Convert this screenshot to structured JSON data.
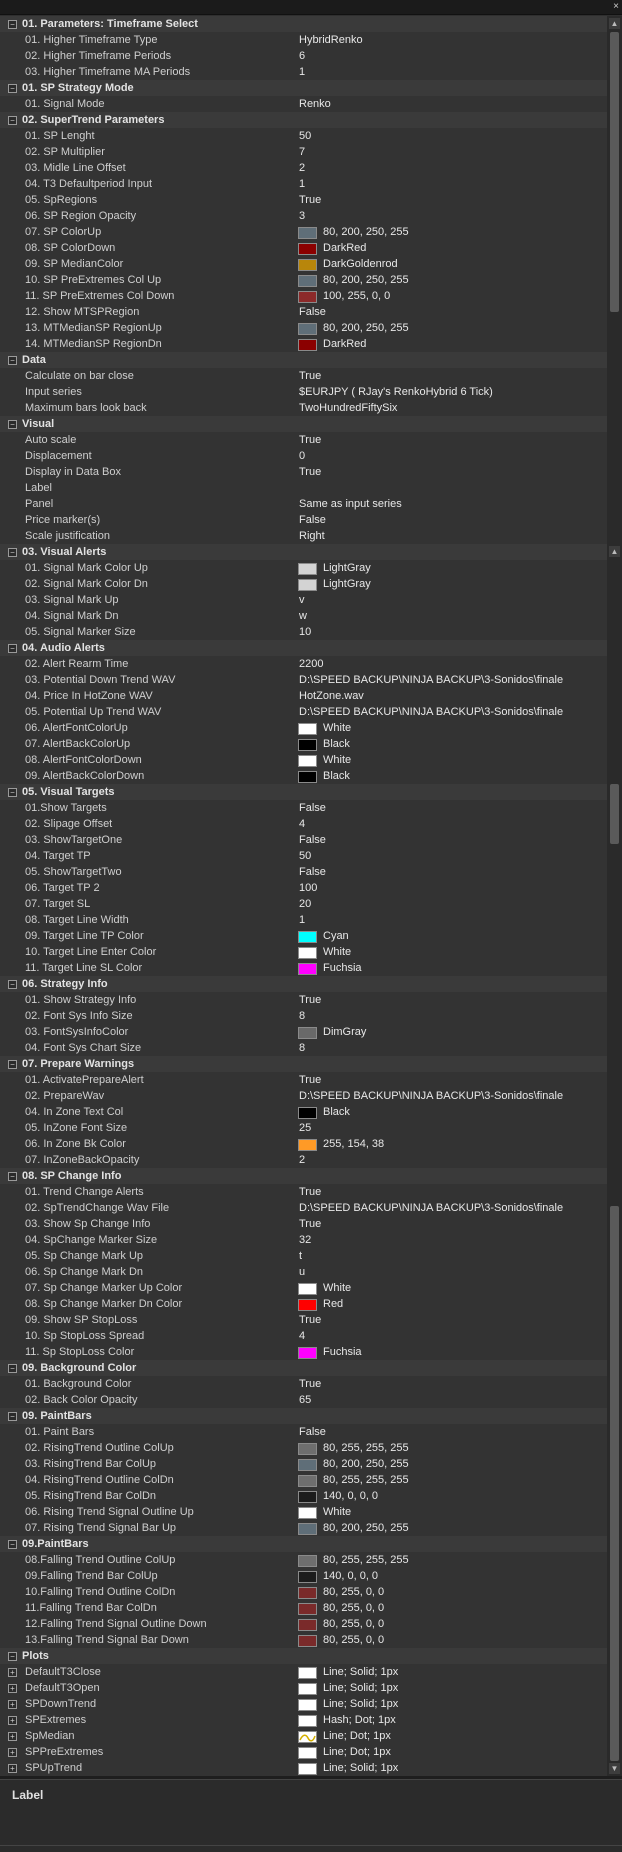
{
  "window": {
    "close_glyph": "×"
  },
  "grid": {
    "categories": [
      {
        "label": "01. Parameters: Timeframe Select",
        "toggle": "−",
        "props": [
          {
            "name": "01. Higher Timeframe Type",
            "value": "HybridRenko"
          },
          {
            "name": "02. Higher Timeframe Periods",
            "value": "6"
          },
          {
            "name": "03. Higher Timeframe MA Periods",
            "value": "1"
          }
        ]
      },
      {
        "label": "01. SP Strategy Mode",
        "toggle": "−",
        "props": [
          {
            "name": "01. Signal Mode",
            "value": "Renko"
          }
        ]
      },
      {
        "label": "02. SuperTrend Parameters",
        "toggle": "−",
        "props": [
          {
            "name": "01. SP Lenght",
            "value": "50"
          },
          {
            "name": "02. SP Multiplier",
            "value": "7"
          },
          {
            "name": "03. Midle Line Offset",
            "value": "2"
          },
          {
            "name": "04. T3 Defaultperiod Input",
            "value": "1"
          },
          {
            "name": "05. SpRegions",
            "value": "True"
          },
          {
            "name": "06. SP Region Opacity",
            "value": "3"
          },
          {
            "name": "07. SP ColorUp",
            "value": "80, 200, 250, 255",
            "swatch": "#5f6e78"
          },
          {
            "name": "08. SP ColorDown",
            "value": "DarkRed",
            "swatch": "#8b0000"
          },
          {
            "name": "09. SP MedianColor",
            "value": "DarkGoldenrod",
            "swatch": "#b8860b"
          },
          {
            "name": "10. SP PreExtremes Col Up",
            "value": "80, 200, 250, 255",
            "swatch": "#5f6e78"
          },
          {
            "name": "11. SP PreExtremes Col Down",
            "value": "100, 255, 0, 0",
            "swatch": "#8c2a2a"
          },
          {
            "name": "12. Show MTSPRegion",
            "value": "False"
          },
          {
            "name": "13. MTMedianSP RegionUp",
            "value": "80, 200, 250, 255",
            "swatch": "#5f6e78"
          },
          {
            "name": "14. MTMedianSP RegionDn",
            "value": "DarkRed",
            "swatch": "#8b0000"
          }
        ]
      },
      {
        "label": "Data",
        "toggle": "−",
        "props": [
          {
            "name": "Calculate on bar close",
            "value": "True"
          },
          {
            "name": "Input series",
            "value": "$EURJPY ( RJay's RenkoHybrid  6 Tick)"
          },
          {
            "name": "Maximum bars look back",
            "value": "TwoHundredFiftySix"
          }
        ]
      },
      {
        "label": "Visual",
        "toggle": "−",
        "props": [
          {
            "name": "Auto scale",
            "value": "True"
          },
          {
            "name": "Displacement",
            "value": "0"
          },
          {
            "name": "Display in Data Box",
            "value": "True"
          },
          {
            "name": "Label",
            "value": ""
          },
          {
            "name": "Panel",
            "value": "Same as input series"
          },
          {
            "name": "Price marker(s)",
            "value": "False"
          },
          {
            "name": "Scale justification",
            "value": "Right"
          }
        ]
      },
      {
        "label": "03. Visual Alerts",
        "toggle": "−",
        "props": [
          {
            "name": "01. Signal Mark Color Up",
            "value": "LightGray",
            "swatch": "#d3d3d3"
          },
          {
            "name": "02. Signal Mark Color Dn",
            "value": "LightGray",
            "swatch": "#d3d3d3"
          },
          {
            "name": "03. Signal Mark Up",
            "value": "v"
          },
          {
            "name": "04. Signal Mark Dn",
            "value": "w"
          },
          {
            "name": "05. Signal Marker Size",
            "value": "10"
          }
        ]
      },
      {
        "label": "04. Audio Alerts",
        "toggle": "−",
        "props": [
          {
            "name": "02. Alert Rearm Time",
            "value": "2200"
          },
          {
            "name": "03. Potential Down Trend WAV",
            "value": "D:\\SPEED BACKUP\\NINJA BACKUP\\3-Sonidos\\finale"
          },
          {
            "name": "04. Price In HotZone WAV",
            "value": "HotZone.wav"
          },
          {
            "name": "05. Potential Up Trend WAV",
            "value": "D:\\SPEED BACKUP\\NINJA BACKUP\\3-Sonidos\\finale"
          },
          {
            "name": "06. AlertFontColorUp",
            "value": "White",
            "swatch": "#ffffff"
          },
          {
            "name": "07. AlertBackColorUp",
            "value": "Black",
            "swatch": "#000000"
          },
          {
            "name": "08. AlertFontColorDown",
            "value": "White",
            "swatch": "#ffffff"
          },
          {
            "name": "09. AlertBackColorDown",
            "value": "Black",
            "swatch": "#000000"
          }
        ]
      },
      {
        "label": "05. Visual Targets",
        "toggle": "−",
        "props": [
          {
            "name": "01.Show Targets",
            "value": "False"
          },
          {
            "name": "02. Slipage Offset",
            "value": "4"
          },
          {
            "name": "03. ShowTargetOne",
            "value": "False"
          },
          {
            "name": "04. Target TP",
            "value": "50"
          },
          {
            "name": "05. ShowTargetTwo",
            "value": "False"
          },
          {
            "name": "06. Target TP 2",
            "value": "100"
          },
          {
            "name": "07. Target SL",
            "value": "20"
          },
          {
            "name": "08. Target Line Width",
            "value": "1"
          },
          {
            "name": "09. Target Line TP Color",
            "value": "Cyan",
            "swatch": "#00ffff"
          },
          {
            "name": "10. Target Line Enter Color",
            "value": "White",
            "swatch": "#ffffff"
          },
          {
            "name": "11. Target Line SL Color",
            "value": "Fuchsia",
            "swatch": "#ff00ff"
          }
        ]
      },
      {
        "label": "06. Strategy Info",
        "toggle": "−",
        "props": [
          {
            "name": " 01. Show Strategy Info",
            "value": "True"
          },
          {
            "name": "02. Font Sys Info Size",
            "value": "8"
          },
          {
            "name": "03. FontSysInfoColor",
            "value": "DimGray",
            "swatch": "#696969"
          },
          {
            "name": "04. Font Sys Chart Size",
            "value": "8"
          }
        ]
      },
      {
        "label": "07. Prepare Warnings",
        "toggle": "−",
        "props": [
          {
            "name": " 01. ActivatePrepareAlert",
            "value": "True"
          },
          {
            "name": "02. PrepareWav",
            "value": "D:\\SPEED BACKUP\\NINJA BACKUP\\3-Sonidos\\finale"
          },
          {
            "name": "04. In Zone Text Col",
            "value": "Black",
            "swatch": "#000000"
          },
          {
            "name": "05. InZone Font Size",
            "value": "25"
          },
          {
            "name": "06. In Zone Bk Color",
            "value": "255, 154, 38",
            "swatch": "#ff9a26"
          },
          {
            "name": "07. InZoneBackOpacity",
            "value": "2"
          }
        ]
      },
      {
        "label": "08. SP Change Info",
        "toggle": "−",
        "props": [
          {
            "name": "01. Trend Change Alerts",
            "value": "True"
          },
          {
            "name": "02. SpTrendChange Wav File",
            "value": "D:\\SPEED BACKUP\\NINJA BACKUP\\3-Sonidos\\finale"
          },
          {
            "name": "03. Show Sp Change Info",
            "value": "True"
          },
          {
            "name": "04. SpChange Marker Size",
            "value": "32"
          },
          {
            "name": "05. Sp Change Mark Up",
            "value": "t"
          },
          {
            "name": "06. Sp Change Mark Dn",
            "value": "u"
          },
          {
            "name": "07. Sp Change Marker Up Color",
            "value": "White",
            "swatch": "#ffffff"
          },
          {
            "name": "08. Sp Change Marker Dn Color",
            "value": "Red",
            "swatch": "#ff0000"
          },
          {
            "name": "09. Show SP StopLoss",
            "value": "True"
          },
          {
            "name": "10. Sp StopLoss Spread",
            "value": "4"
          },
          {
            "name": "11. Sp StopLoss Color",
            "value": "Fuchsia",
            "swatch": "#ff00ff"
          }
        ]
      },
      {
        "label": "09. Background Color",
        "toggle": "−",
        "props": [
          {
            "name": "01. Background Color",
            "value": "True"
          },
          {
            "name": "02. Back Color  Opacity",
            "value": "65"
          }
        ]
      },
      {
        "label": "09. PaintBars",
        "toggle": "−",
        "props": [
          {
            "name": "01. Paint Bars",
            "value": "False"
          },
          {
            "name": "02. RisingTrend Outline ColUp",
            "value": "80, 255, 255, 255",
            "swatch": "#6e6e6e"
          },
          {
            "name": "03. RisingTrend Bar ColUp",
            "value": "80, 200, 250, 255",
            "swatch": "#5f6e78"
          },
          {
            "name": "04. RisingTrend Outline ColDn",
            "value": "80, 255, 255, 255",
            "swatch": "#6e6e6e"
          },
          {
            "name": "05. RisingTrend Bar ColDn",
            "value": "140, 0, 0, 0",
            "swatch": "#1c1c1c"
          },
          {
            "name": "06. Rising Trend Signal Outline Up",
            "value": "White",
            "swatch": "#ffffff"
          },
          {
            "name": "07. Rising Trend Signal Bar Up",
            "value": "80, 200, 250, 255",
            "swatch": "#5f6e78"
          }
        ]
      },
      {
        "label": "09.PaintBars",
        "toggle": "−",
        "props": [
          {
            "name": "08.Falling Trend Outline ColUp",
            "value": "80, 255, 255, 255",
            "swatch": "#6e6e6e"
          },
          {
            "name": "09.Falling Trend Bar ColUp",
            "value": "140, 0, 0, 0",
            "swatch": "#1c1c1c"
          },
          {
            "name": "10.Falling Trend Outline ColDn",
            "value": "80, 255, 0, 0",
            "swatch": "#7a2a2a"
          },
          {
            "name": "11.Falling Trend Bar ColDn",
            "value": "80, 255, 0, 0",
            "swatch": "#7a2a2a"
          },
          {
            "name": "12.Falling Trend Signal Outline Down",
            "value": "80, 255, 0, 0",
            "swatch": "#7a2a2a"
          },
          {
            "name": "13.Falling Trend Signal Bar Down",
            "value": "80, 255, 0, 0",
            "swatch": "#7a2a2a"
          }
        ]
      },
      {
        "label": "Plots",
        "toggle": "−",
        "props": [
          {
            "name": "DefaultT3Close",
            "value": "Line; Solid; 1px",
            "swatch": "#ffffff",
            "expand": "+"
          },
          {
            "name": "DefaultT3Open",
            "value": "Line; Solid; 1px",
            "swatch": "#ffffff",
            "expand": "+"
          },
          {
            "name": "SPDownTrend",
            "value": "Line; Solid; 1px",
            "swatch": "#ffffff",
            "expand": "+"
          },
          {
            "name": "SPExtremes",
            "value": "Hash; Dot; 1px",
            "swatch": "#ffffff",
            "expand": "+"
          },
          {
            "name": "SpMedian",
            "value": "Line; Dot; 1px",
            "swatch": "wave",
            "expand": "+"
          },
          {
            "name": "SPPreExtremes",
            "value": "Line; Dot; 1px",
            "swatch": "#ffffff",
            "expand": "+"
          },
          {
            "name": "SPUpTrend",
            "value": "Line; Solid; 1px",
            "swatch": "#ffffff",
            "expand": "+"
          }
        ]
      }
    ]
  },
  "scrollbar": {
    "up_glyph": "▲",
    "down_glyph": "▼"
  },
  "description": {
    "title": "Label"
  }
}
